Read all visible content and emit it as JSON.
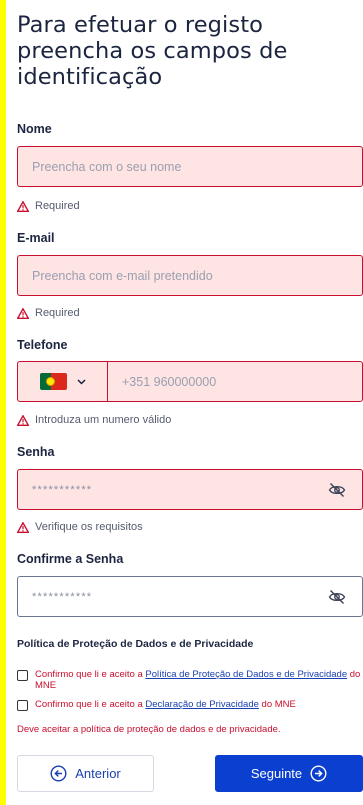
{
  "title": "Para efetuar o registo preencha os campos de identificação",
  "nome": {
    "label": "Nome",
    "placeholder": "Preencha com o seu nome",
    "error": "Required"
  },
  "email": {
    "label": "E-mail",
    "placeholder": "Preencha com e-mail pretendido",
    "error": "Required"
  },
  "telefone": {
    "label": "Telefone",
    "country_icon": "portugal-flag-icon",
    "placeholder": "+351 960000000",
    "error": "Introduza um numero válido"
  },
  "senha": {
    "label": "Senha",
    "placeholder": "***********",
    "error": "Verifique os requisitos"
  },
  "confirme": {
    "label": "Confirme a Senha",
    "placeholder": "***********"
  },
  "politica": {
    "heading": "Política de Proteção de Dados e de Privacidade",
    "check1_pre": "Confirmo que li e aceito a ",
    "check1_link": "Política de Proteção de Dados e de Privacidade",
    "check1_post": " do MNE",
    "check2_pre": "Confirmo que li e aceito a ",
    "check2_link": "Declaração de Privacidade",
    "check2_post": " do MNE",
    "error": "Deve aceitar a política de proteção de dados e de privacidade."
  },
  "buttons": {
    "prev": "Anterior",
    "next": "Seguinte"
  },
  "colors": {
    "error": "#c8102e",
    "error_bg": "#ffe4e4",
    "primary": "#0b3fd0",
    "page_bg": "#ffff00"
  }
}
